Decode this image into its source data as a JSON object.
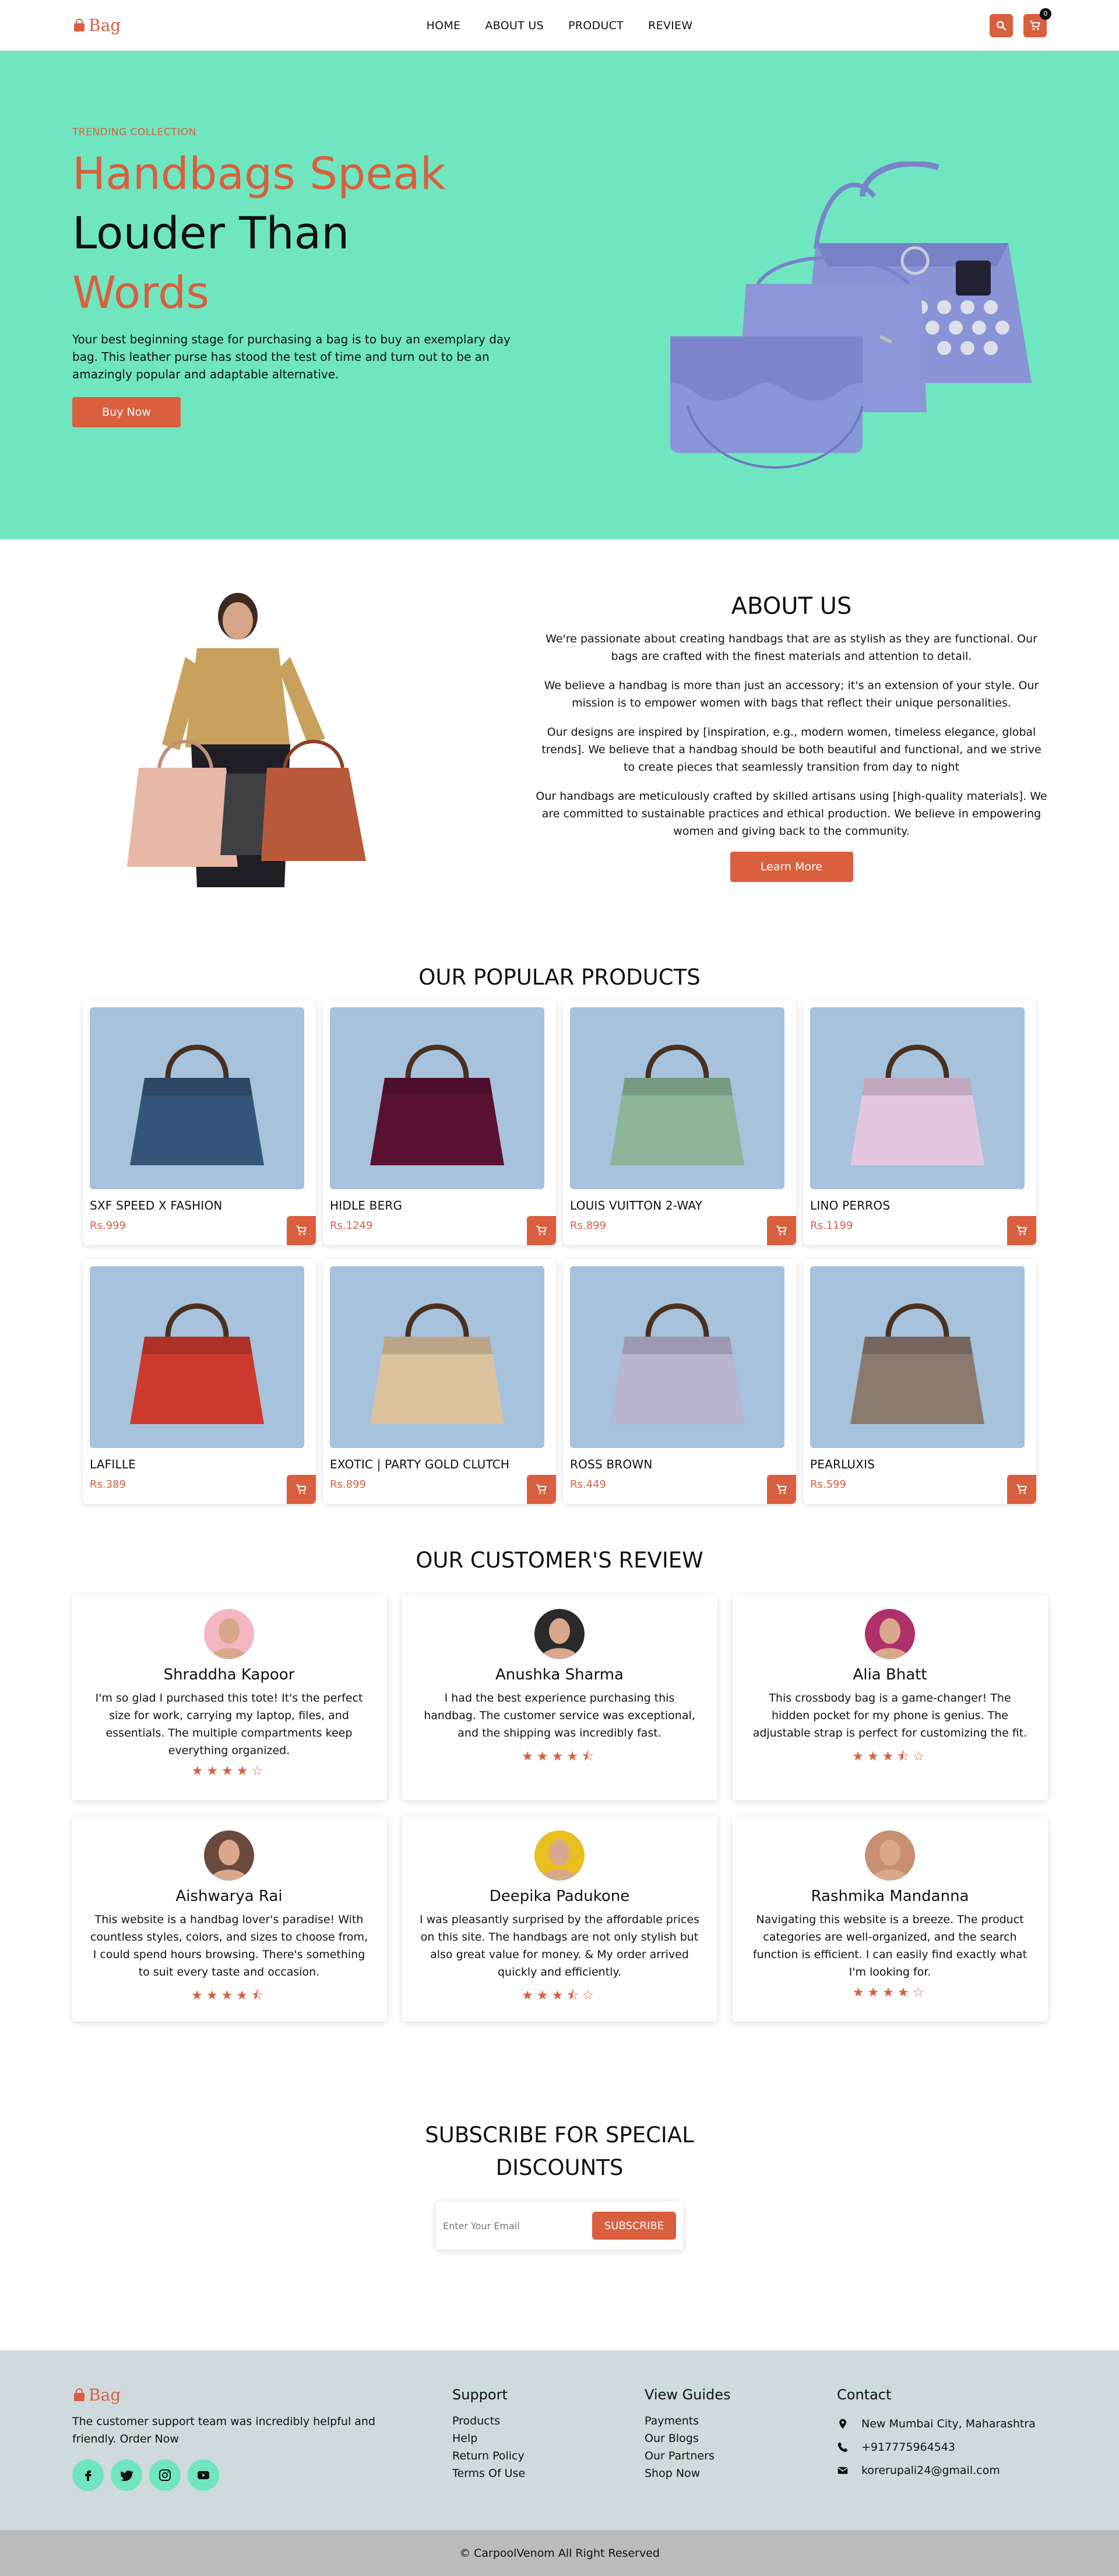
{
  "header": {
    "logo_text": "Bag",
    "nav": [
      "HOME",
      "ABOUT US",
      "PRODUCT",
      "REVIEW"
    ],
    "cart_count": "0",
    "accent": "#d95f3f"
  },
  "hero": {
    "kicker": "TRENDING COLLECTION",
    "title_line1": "Handbags Speak",
    "title_line2": "Louder Than",
    "title_line3": "Words",
    "paragraph": "Your best beginning stage for purchasing a bag is to buy an exemplary day bag. This leather purse has stood the test of time and turn out to be an amazingly popular and adaptable alternative.",
    "button": "Buy Now",
    "bg_color": "#6fe6c0"
  },
  "about": {
    "title": "ABOUT US",
    "paragraphs": [
      "We're passionate about creating handbags that are as stylish as they are functional. Our bags are crafted with the finest materials and attention to detail.",
      "We believe a handbag is more than just an accessory; it's an extension of your style. Our mission is to empower women with bags that reflect their unique personalities.",
      "Our designs are inspired by [inspiration, e.g., modern women, timeless elegance, global trends]. We believe that a handbag should be both beautiful and functional, and we strive to create pieces that seamlessly transition from day to night",
      "Our handbags are meticulously crafted by skilled artisans using [high-quality materials]. We are committed to sustainable practices and ethical production. We believe in empowering women and giving back to the community."
    ],
    "button": "Learn More"
  },
  "products": {
    "title": "OUR POPULAR PRODUCTS",
    "items": [
      {
        "name": "SXF SPEED X FASHION",
        "price": "Rs.999",
        "color": "#35557a"
      },
      {
        "name": "HIDLE BERG",
        "price": "Rs.1249",
        "color": "#5a1233"
      },
      {
        "name": "LOUIS VUITTON 2-WAY",
        "price": "Rs.899",
        "color": "#8cb59a"
      },
      {
        "name": "LINO PERROS",
        "price": "Rs.1199",
        "color": "#e4c6df"
      },
      {
        "name": "LAFILLE",
        "price": "Rs.389",
        "color": "#cc3a2e"
      },
      {
        "name": "EXOTIC | PARTY GOLD CLUTCH",
        "price": "Rs.899",
        "color": "#dcc3a0"
      },
      {
        "name": "ROSS BROWN",
        "price": "Rs.449",
        "color": "#b9b4d2"
      },
      {
        "name": "PEARLUXIS",
        "price": "Rs.599",
        "color": "#8a7a70"
      }
    ]
  },
  "reviews": {
    "title": "OUR CUSTOMER'S REVIEW",
    "items": [
      {
        "name": "Shraddha Kapoor",
        "text": "I'm so glad I purchased this tote! It's the perfect size for work, carrying my laptop, files, and essentials. The multiple compartments keep everything organized.",
        "stars": "★★★★☆",
        "avatar_bg": "#f4b7c2"
      },
      {
        "name": "Anushka Sharma",
        "text": "I had the best experience purchasing this handbag. The customer service was exceptional, and the shipping was incredibly fast.",
        "stars": "★★★★⯪",
        "avatar_bg": "#2a2a2a"
      },
      {
        "name": "Alia Bhatt",
        "text": "This crossbody bag is a game-changer! The hidden pocket for my phone is genius. The adjustable strap is perfect for customizing the fit.",
        "stars": "★★★⯪☆",
        "avatar_bg": "#b0306a"
      },
      {
        "name": "Aishwarya Rai",
        "text": "This website is a handbag lover's paradise! With countless styles, colors, and sizes to choose from, I could spend hours browsing. There's something to suit every taste and occasion.",
        "stars": "★★★★⯪",
        "avatar_bg": "#6a4a3c"
      },
      {
        "name": "Deepika Padukone",
        "text": "I was pleasantly surprised by the affordable prices on this site. The handbags are not only stylish but also great value for money. & My order arrived quickly and efficiently.",
        "stars": "★★★⯪☆",
        "avatar_bg": "#e8c020"
      },
      {
        "name": "Rashmika Mandanna",
        "text": "Navigating this website is a breeze. The product categories are well-organized, and the search function is efficient. I can easily find exactly what I'm looking for.",
        "stars": "★★★★☆",
        "avatar_bg": "#c89070"
      }
    ]
  },
  "subscribe": {
    "title_line1": "SUBSCRIBE FOR SPECIAL",
    "title_line2": "DISCOUNTS",
    "placeholder": "Enter Your Email",
    "button": "SUBSCRIBE"
  },
  "footer": {
    "logo_text": "Bag",
    "description": "The customer support team was incredibly helpful and friendly. Order Now",
    "support": {
      "title": "Support",
      "links": [
        "Products",
        "Help",
        "Return Policy",
        "Terms Of Use"
      ]
    },
    "guides": {
      "title": "View Guides",
      "links": [
        "Payments",
        "Our Blogs",
        "Our Partners",
        "Shop Now"
      ]
    },
    "contact": {
      "title": "Contact",
      "address": "New Mumbai City, Maharashtra",
      "phone": "+917775964543",
      "email": "korerupali24@gmail.com"
    },
    "copyright": "© CarpoolVenom All Right Reserved",
    "bg_color": "#cfdadc"
  }
}
